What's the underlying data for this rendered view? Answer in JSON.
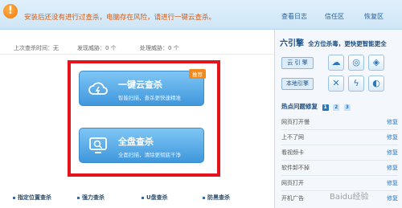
{
  "alert": {
    "icon": "exclamation-icon",
    "message": "安装后还没有进行过查杀，电脑存在风险，请进行一键云查杀。",
    "accent": "#d95b12"
  },
  "top_links": [
    "查看日志",
    "信任区",
    "恢复区"
  ],
  "stats": {
    "last_scan": "上次查杀时间：无",
    "found_threats": "发现威胁：0 个",
    "handled_threats": "处理威胁：0 个"
  },
  "scan_options": [
    {
      "title": "一键云查杀",
      "desc": "智能扫描，查杀更快速精准",
      "badge": "推荐",
      "icon": "cloud-scan-icon"
    },
    {
      "title": "全盘查杀",
      "desc": "全面扫描，清除更彻底干净",
      "icon": "monitor-scan-icon"
    }
  ],
  "bottom_links": [
    "指定位置查杀",
    "强力查杀",
    "U盘查杀",
    "防黑查杀"
  ],
  "right_panel": {
    "title": "六引擎",
    "slogan": "全方位杀毒，更快更智能更全",
    "engines": [
      {
        "label": "云 引 擎",
        "icons": [
          "cloud-engine-icon",
          "orbit-engine-icon",
          "shield-engine-icon"
        ]
      },
      {
        "label": "本地引擎",
        "icons": [
          "tools-engine-icon",
          "lightning-engine-icon",
          "defense-engine-icon"
        ]
      }
    ],
    "faq_title": "热点问题修复",
    "faq_pages": [
      "1",
      "2",
      "3"
    ],
    "faq_items": [
      {
        "question": "网页打开慢",
        "fix": "修复"
      },
      {
        "question": "上不了网",
        "fix": "修复"
      },
      {
        "question": "看视频卡",
        "fix": "修复"
      },
      {
        "question": "软件卸不掉",
        "fix": "修复"
      },
      {
        "question": "网页打开",
        "fix": "修复"
      },
      {
        "question": "开机广告",
        "fix": "修复"
      }
    ]
  },
  "watermark": "Baidu经验",
  "colors": {
    "brand": "#2a76bd",
    "card": "#4ba1e0",
    "highlight_frame": "#e3141b",
    "badge": "#f08a1c"
  }
}
